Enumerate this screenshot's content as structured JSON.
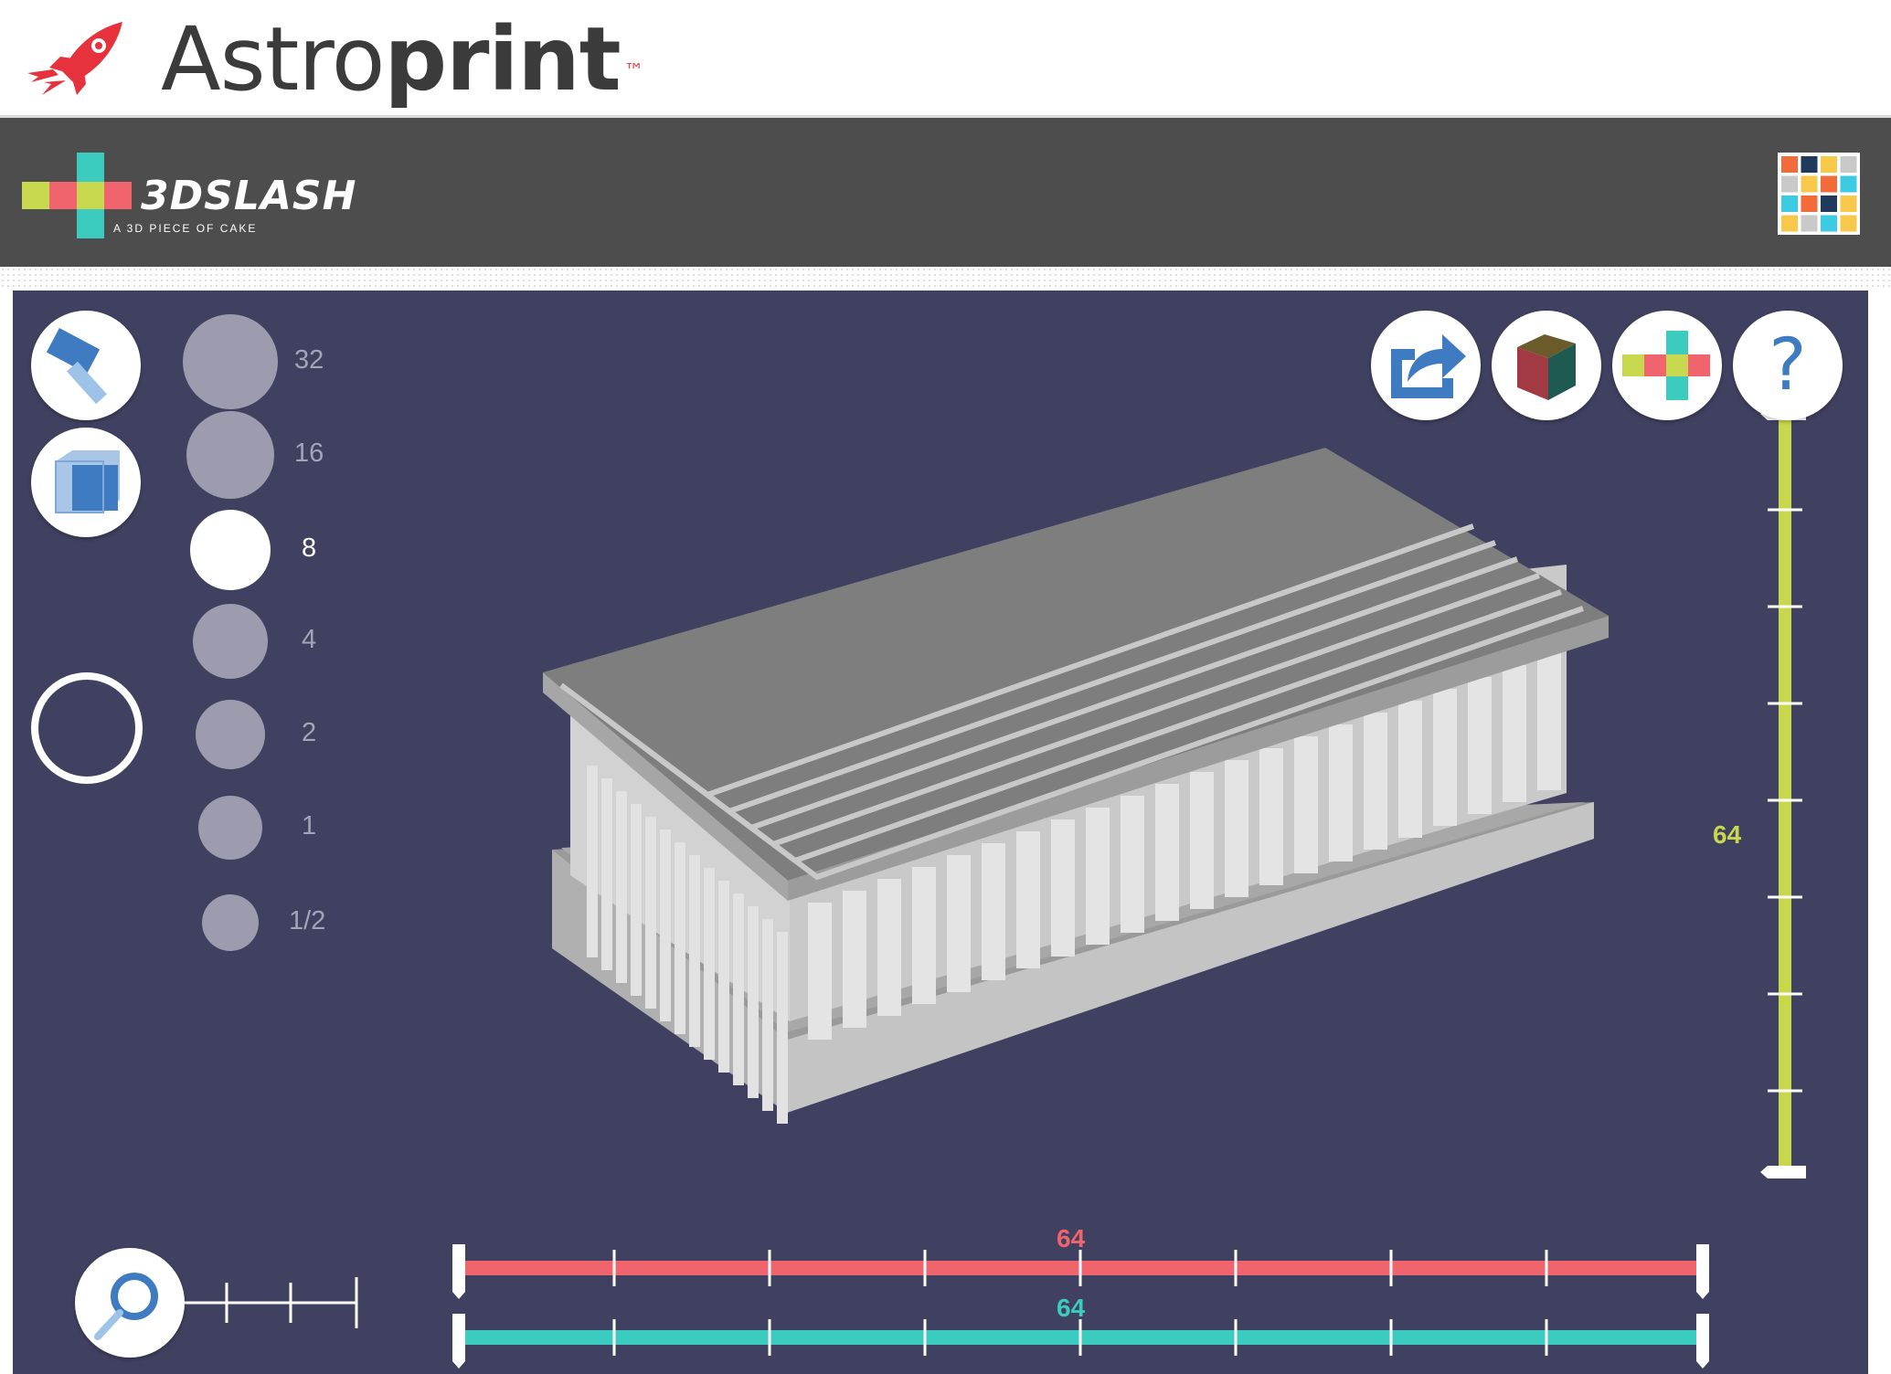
{
  "header": {
    "brand_light": "Astro",
    "brand_bold": "print",
    "trademark": "™"
  },
  "app_bar": {
    "logo_text": "3DSLASH",
    "logo_tagline": "A 3D PIECE OF CAKE",
    "apps_grid_colors": [
      "#f26b3a",
      "#1f3a5a",
      "#f7c84a",
      "#c9c9c9",
      "#c9c9c9",
      "#f7c84a",
      "#f26b3a",
      "#3ccbe0",
      "#3ccbe0",
      "#f26b3a",
      "#1f3a5a",
      "#f7c84a",
      "#f7c84a",
      "#c9c9c9",
      "#3ccbe0",
      "#f7c84a"
    ]
  },
  "tools": {
    "hammer": "hammer-icon",
    "cube_tool": "cube-tool-icon",
    "ring_tool": "ring-tool-icon"
  },
  "tool_sizes": {
    "items": [
      {
        "label": "32",
        "active": false
      },
      {
        "label": "16",
        "active": false
      },
      {
        "label": "8",
        "active": true
      },
      {
        "label": "4",
        "active": false
      },
      {
        "label": "2",
        "active": false
      },
      {
        "label": "1",
        "active": false
      },
      {
        "label": "1/2",
        "active": false
      }
    ]
  },
  "top_right_actions": {
    "export": "export-icon",
    "color_cube": "color-cube-icon",
    "slash_menu": "slash-logo-icon",
    "help_label": "?"
  },
  "sliders": {
    "vertical": {
      "value": "64",
      "color": "#c8d84e"
    },
    "horizontal_red": {
      "value": "64",
      "color": "#f0646e"
    },
    "horizontal_teal": {
      "value": "64",
      "color": "#3ccbbf"
    }
  },
  "zoom": {
    "icon": "magnifier-icon"
  },
  "colors": {
    "workspace_bg": "#404060",
    "header_bar": "#4d4d4d"
  }
}
